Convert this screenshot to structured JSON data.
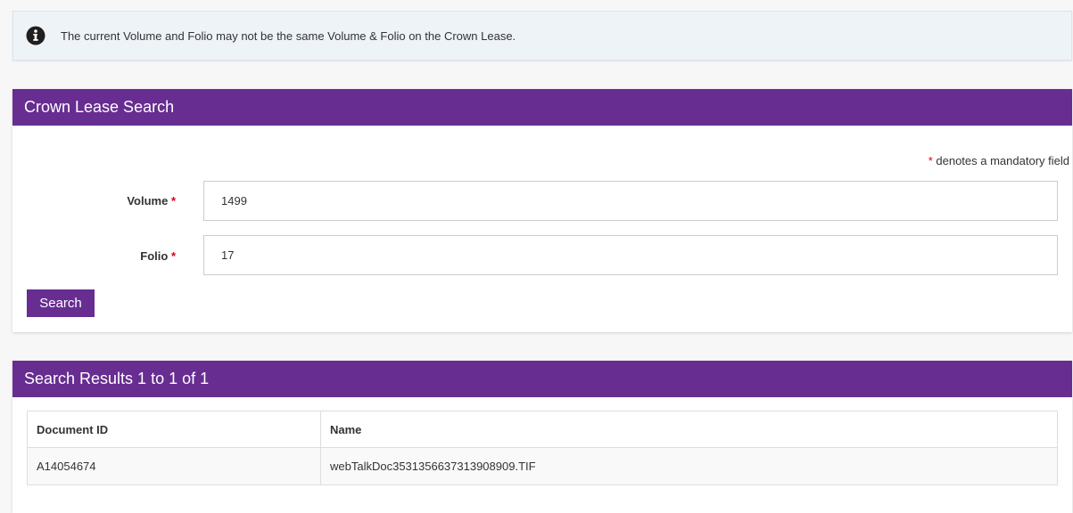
{
  "notice": {
    "icon": "info-icon",
    "text": "The current Volume and Folio may not be the same Volume & Folio on the Crown Lease."
  },
  "search_panel": {
    "title": "Crown Lease Search",
    "mandatory_star": "*",
    "mandatory_note": "denotes a mandatory field",
    "volume": {
      "label": "Volume",
      "star": "*",
      "value": "1499"
    },
    "folio": {
      "label": "Folio",
      "star": "*",
      "value": "17"
    },
    "search_label": "Search"
  },
  "results_panel": {
    "title": "Search Results 1 to 1 of 1",
    "columns": [
      "Document ID",
      "Name"
    ],
    "rows": [
      [
        "A14054674",
        "webTalkDoc3531356637313908909.TIF"
      ]
    ]
  },
  "colors": {
    "accent": "#672d91",
    "required": "#d9001b",
    "notice_bg": "#eef3f8"
  }
}
